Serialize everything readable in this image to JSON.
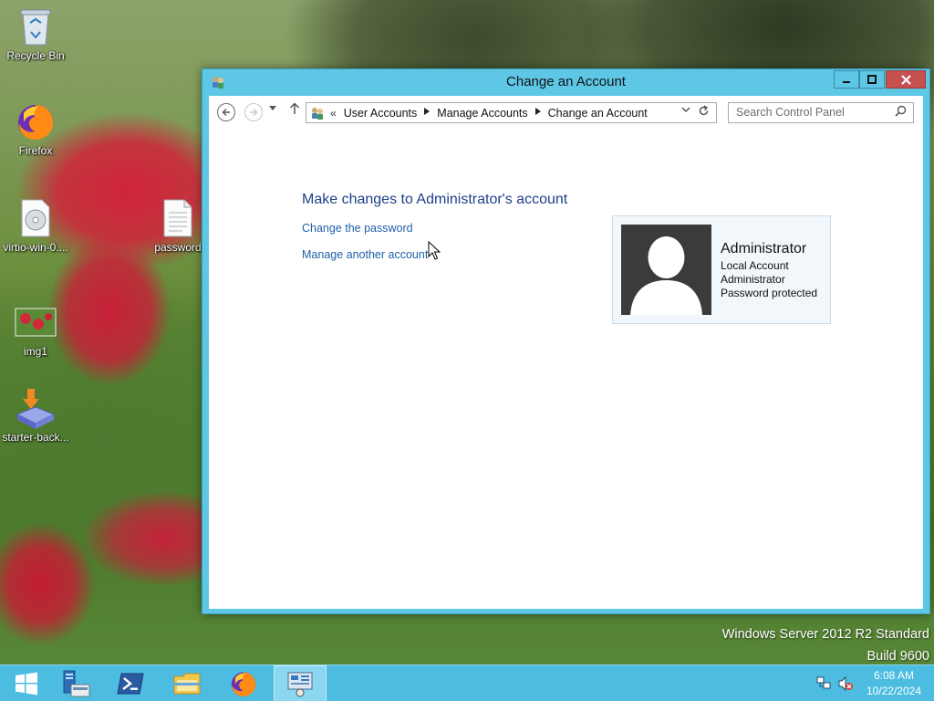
{
  "desktop": {
    "icons": [
      {
        "label": "Recycle Bin",
        "icon": "recycle-bin-icon"
      },
      {
        "label": "Firefox",
        "icon": "firefox-icon"
      },
      {
        "label": "virtio-win-0....",
        "icon": "disc-image-icon"
      },
      {
        "label": "password",
        "icon": "text-document-icon"
      },
      {
        "label": "img1",
        "icon": "image-file-icon"
      },
      {
        "label": "starter-back...",
        "icon": "installer-icon"
      }
    ]
  },
  "window": {
    "title": "Change an Account",
    "address": {
      "chevron": "«",
      "crumbs": [
        "User Accounts",
        "Manage Accounts",
        "Change an Account"
      ]
    },
    "search_placeholder": "Search Control Panel",
    "heading": "Make changes to Administrator's account",
    "tasks": [
      "Change the password",
      "Manage another account"
    ],
    "account": {
      "name": "Administrator",
      "details": [
        "Local Account",
        "Administrator",
        "Password protected"
      ]
    }
  },
  "watermark": {
    "line1": "Windows Server 2012 R2 Standard",
    "line2": "Build 9600"
  },
  "taskbar": {
    "buttons": [
      "start-icon",
      "server-manager-icon",
      "powershell-icon",
      "file-explorer-icon",
      "firefox-icon",
      "control-panel-icon"
    ],
    "active": "control-panel-icon"
  },
  "clock": {
    "time": "6:08 AM",
    "date": "10/22/2024"
  }
}
